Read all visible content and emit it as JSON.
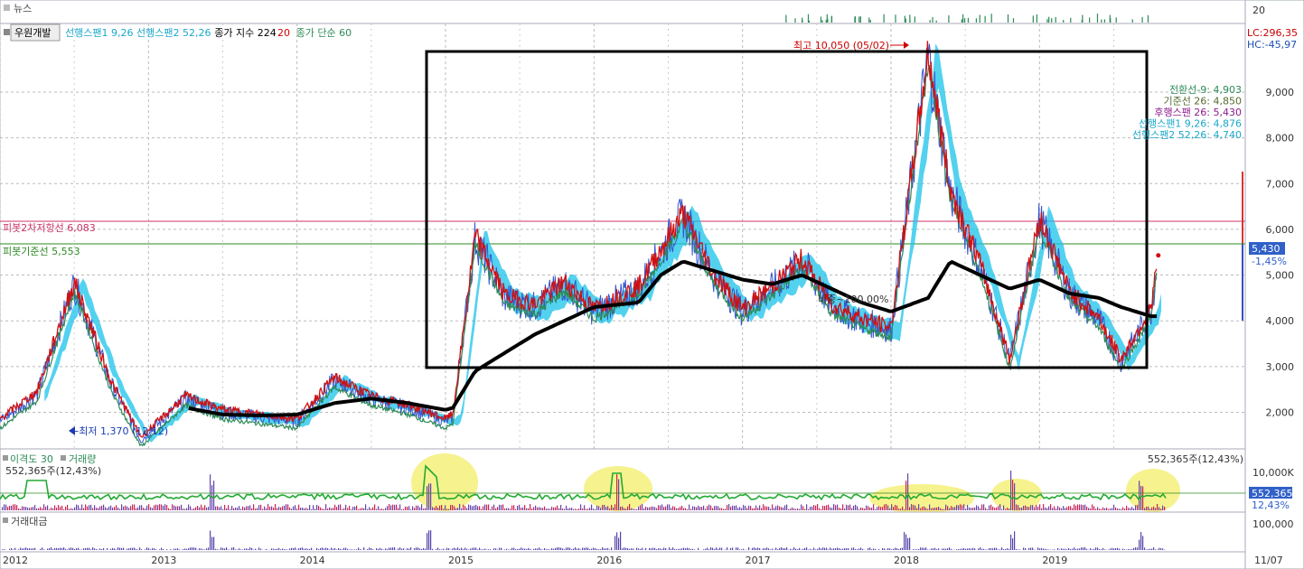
{
  "news_panel": {
    "title": "뉴스",
    "axis_value": "20"
  },
  "header": {
    "stock_name": "우원개발",
    "legend_items": [
      {
        "text": "선행스팬1 9,26",
        "color": "#1aa7c9"
      },
      {
        "text": "선행스팬2 52,26",
        "color": "#1aa7c9"
      },
      {
        "text": "종가 지수 224",
        "color": "#000000"
      },
      {
        "text": "20",
        "color": "#cc0000"
      },
      {
        "text": "종가 단순 60",
        "color": "#2e8b57"
      }
    ]
  },
  "price_axis": {
    "ticks": [
      "9,000",
      "8,000",
      "7,000",
      "6,000",
      "5,000",
      "4,000",
      "3,000",
      "2,000"
    ],
    "lc_label": "LC:296,35",
    "hc_label": "HC:-45,97",
    "current_price": "5,430",
    "current_change": "-1,45%"
  },
  "annotations": {
    "high": "최고 10,050 (05/02)",
    "low": "←최저 1,370 (12/12)",
    "pivot_resist": "피봇2차저항선 6,083",
    "pivot_base": "피봇기준선 5,553",
    "midline": "비중~100,00%"
  },
  "ichimoku_legend": [
    {
      "text": "전환선-9: 4,903",
      "color": "#2e8b57"
    },
    {
      "text": "기준선 26: 4,850",
      "color": "#556b2f"
    },
    {
      "text": "후행스팬 26: 5,430",
      "color": "#8b1a8b"
    },
    {
      "text": "선행스팬1 9,26: 4,876",
      "color": "#1aa7c9"
    },
    {
      "text": "선행스팬2 52,26: 4,740",
      "color": "#1aa7c9"
    }
  ],
  "volume_panel": {
    "label_disparity": "이격도 30",
    "label_volume": "거래량",
    "value_left": "552,365주(12,43%)",
    "value_right": "552,365주(12,43%)",
    "axis_top": "10,000K",
    "axis_current": "552,365",
    "axis_percent": "12,43%"
  },
  "amount_panel": {
    "title": "거래대금",
    "axis_top": "100,000"
  },
  "x_axis": {
    "labels": [
      "2012",
      "2013",
      "2014",
      "2015",
      "2016",
      "2017",
      "2018",
      "2019"
    ],
    "end_date": "11/07"
  },
  "chart_data": {
    "type": "line",
    "title": "우원개발",
    "x": [
      2012.0,
      2012.25,
      2012.5,
      2012.75,
      2012.95,
      2013.25,
      2013.5,
      2013.75,
      2014.0,
      2014.25,
      2014.5,
      2014.75,
      2015.0,
      2015.05,
      2015.2,
      2015.4,
      2015.6,
      2015.8,
      2016.0,
      2016.3,
      2016.45,
      2016.6,
      2016.8,
      2017.0,
      2017.2,
      2017.4,
      2017.6,
      2017.8,
      2018.0,
      2018.25,
      2018.4,
      2018.6,
      2018.8,
      2019.0,
      2019.2,
      2019.4,
      2019.55,
      2019.75,
      2019.8
    ],
    "series": [
      {
        "name": "종가",
        "values": [
          1800,
          2400,
          4800,
          2600,
          1400,
          2300,
          2000,
          1900,
          1800,
          2700,
          2300,
          2100,
          1800,
          1900,
          5800,
          4500,
          4300,
          4800,
          4200,
          4700,
          5500,
          6300,
          5000,
          4200,
          4700,
          5300,
          4300,
          4000,
          3800,
          9800,
          6800,
          5200,
          3100,
          6200,
          4600,
          4000,
          3100,
          4200,
          5430
        ]
      },
      {
        "name": "종가 지수 224",
        "values": [
          null,
          null,
          null,
          null,
          null,
          2100,
          1950,
          1930,
          1950,
          2200,
          2300,
          2200,
          2050,
          2100,
          2900,
          3300,
          3700,
          4000,
          4300,
          4400,
          5000,
          5300,
          5100,
          4900,
          4800,
          5000,
          4700,
          4400,
          4200,
          4500,
          5300,
          5000,
          4700,
          4900,
          4600,
          4500,
          4300,
          4100,
          4100
        ]
      }
    ],
    "ylim": [
      1200,
      10500
    ],
    "yticks": [
      2000,
      3000,
      4000,
      5000,
      6000,
      7000,
      8000,
      9000
    ],
    "xlabels": [
      "2012",
      "2013",
      "2014",
      "2015",
      "2016",
      "2017",
      "2018",
      "2019"
    ]
  }
}
